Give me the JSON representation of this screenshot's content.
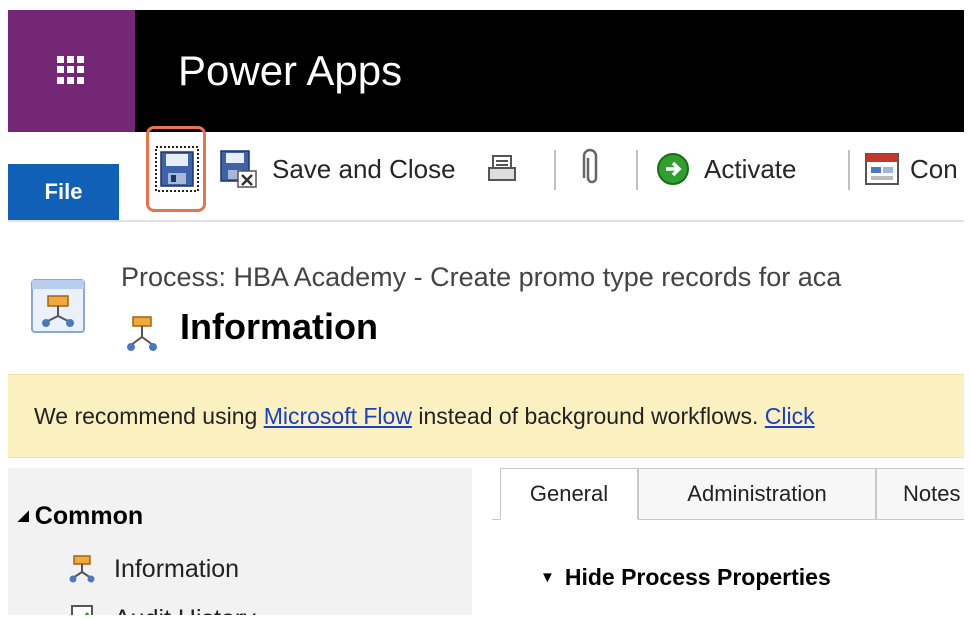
{
  "app": {
    "title": "Power Apps"
  },
  "ribbon": {
    "file_label": "File",
    "save_and_close_label": "Save and Close",
    "activate_label": "Activate",
    "convert_label": "Con"
  },
  "header": {
    "process_title": "Process: HBA Academy - Create promo type records for aca",
    "form_title": "Information"
  },
  "banner": {
    "text_before": "We recommend using ",
    "link_label": "Microsoft Flow",
    "text_after": " instead of background workflows. ",
    "click_label": "Click"
  },
  "sidebar": {
    "group_label": "Common",
    "items": [
      {
        "label": "Information"
      },
      {
        "label": "Audit History"
      }
    ]
  },
  "tabs": [
    {
      "label": "General"
    },
    {
      "label": "Administration"
    },
    {
      "label": "Notes"
    }
  ],
  "section": {
    "toggle_label": "Hide Process Properties"
  },
  "colors": {
    "waffle_bg": "#742774",
    "file_tab": "#1160b7",
    "highlight": "#e8744d",
    "banner_bg": "#fbf1c0",
    "link": "#1a3fc4"
  }
}
